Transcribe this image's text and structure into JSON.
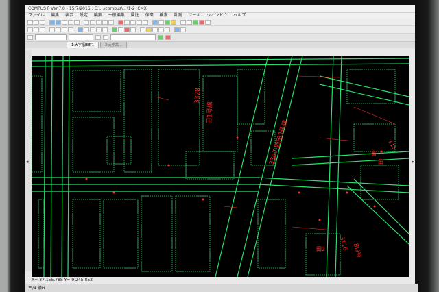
{
  "window": {
    "title": "COMPUS F Ver.7.0 - 15/7/2016 : C:\\...\\compus\\...\\1-2 .CMX"
  },
  "menu": [
    "ファイル",
    "編集",
    "表示",
    "設定",
    "編集",
    "一般編集",
    "属性",
    "作図",
    "検索",
    "計測",
    "ツール",
    "ウィンドウ",
    "ヘルプ"
  ],
  "tabs": [
    "1:大字福田町1",
    "2:大字高..."
  ],
  "map_labels": {
    "route_a": "3328",
    "route_a_name": "田1号線",
    "route_b": "3307-西田3号線",
    "route_c": "3116",
    "route_c_name": "田3号",
    "route_d": "田2",
    "block_1": "富",
    "block_2": "田",
    "block_3": "115"
  },
  "coords": "X=-37,155.788  Y=-9,245.852",
  "status": "三/4  横H"
}
